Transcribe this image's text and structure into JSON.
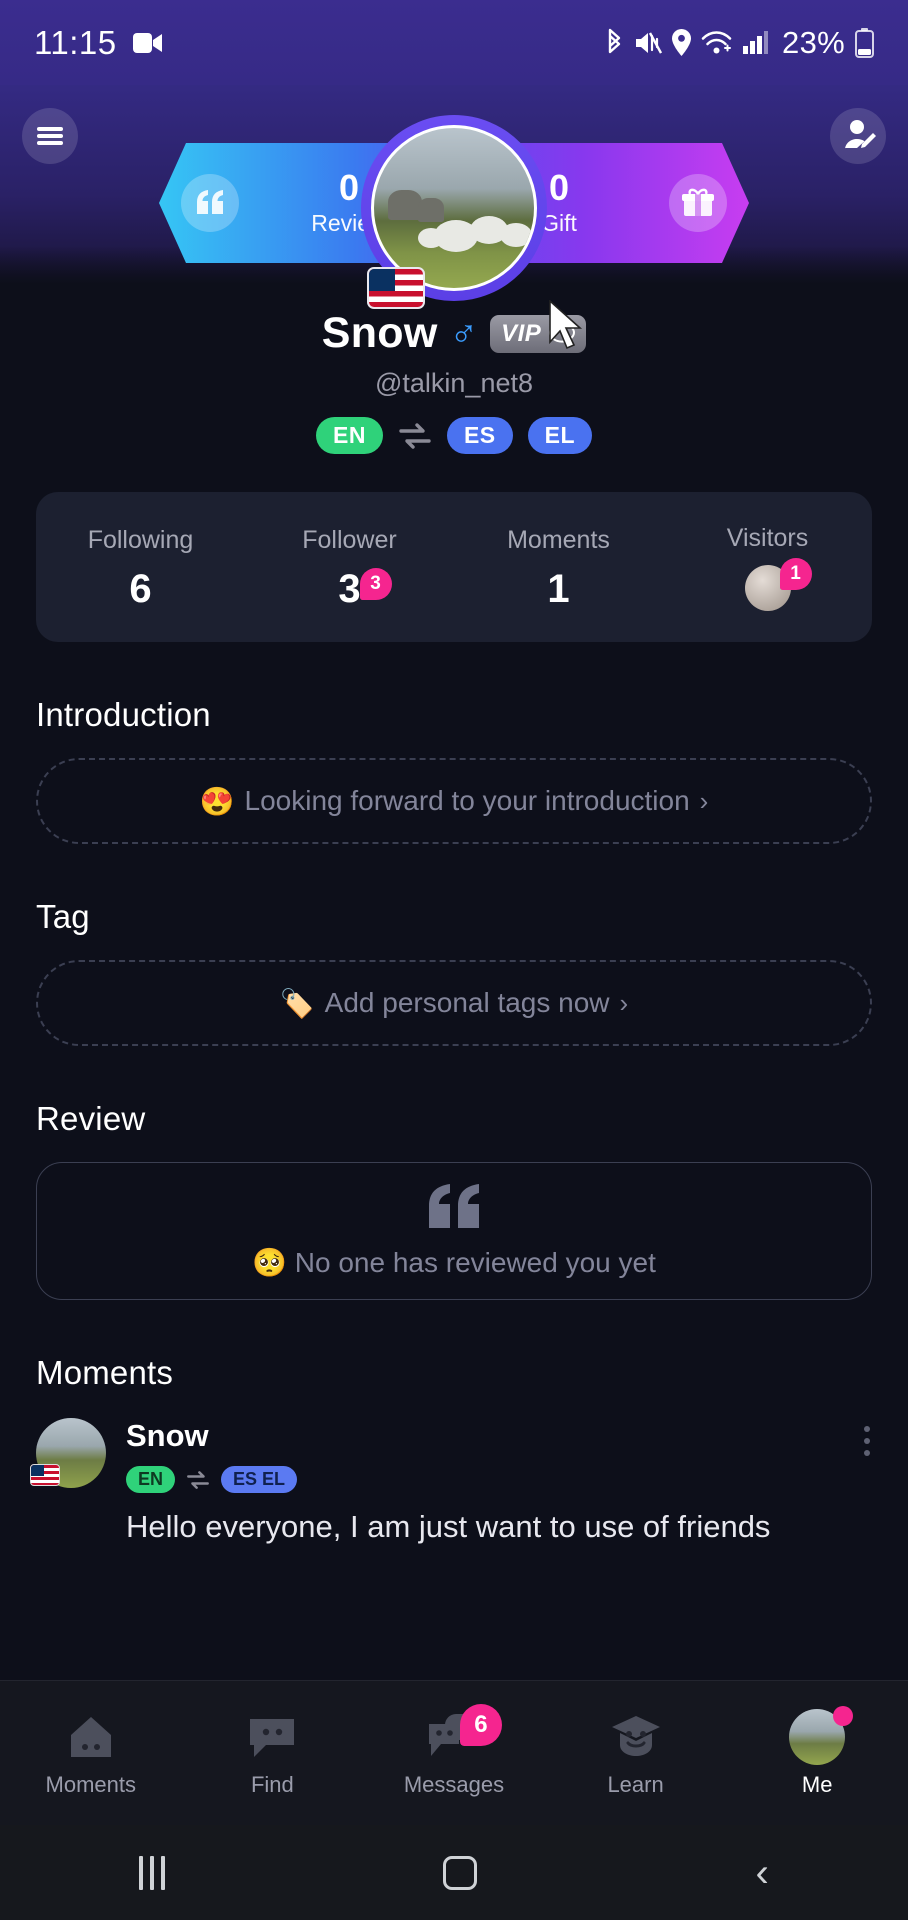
{
  "statusbar": {
    "time": "11:15",
    "battery_percent": "23%",
    "icons": [
      "video-camera-icon",
      "bluetooth-icon",
      "mute-icon",
      "location-icon",
      "wifi-icon",
      "cellular-signal-icon",
      "battery-icon"
    ]
  },
  "header": {
    "menu_icon": "hamburger-menu-icon",
    "edit_profile_icon": "edit-profile-icon",
    "review": {
      "count": "0",
      "label": "Review",
      "icon": "quote-icon"
    },
    "gift": {
      "count": "0",
      "label": "Gift",
      "icon": "gift-icon"
    },
    "avatar_flag": "us-flag-icon"
  },
  "identity": {
    "name": "Snow",
    "gender_icon": "male-gender-icon",
    "vip_label": "VIP",
    "vip_icon": "speech-bubble-icon",
    "handle": "@talkin_net8",
    "native_language": "EN",
    "swap_icon": "language-swap-icon",
    "learning_languages": [
      "ES",
      "EL"
    ]
  },
  "stats": [
    {
      "label": "Following",
      "value": "6",
      "badge": ""
    },
    {
      "label": "Follower",
      "value": "3",
      "badge": "3"
    },
    {
      "label": "Moments",
      "value": "1",
      "badge": ""
    },
    {
      "label": "Visitors",
      "value": "",
      "badge": "1"
    }
  ],
  "introduction": {
    "title": "Introduction",
    "placeholder": "Looking forward to your introduction",
    "emoji": "😍",
    "chevron": "›"
  },
  "tag": {
    "title": "Tag",
    "placeholder": "Add personal tags now",
    "emoji": "🏷️",
    "chevron": "›"
  },
  "review_section": {
    "title": "Review",
    "quote_icon": "quote-icon",
    "empty_text": "No one has reviewed you yet",
    "emoji": "🥺"
  },
  "moments_section": {
    "title": "Moments",
    "post": {
      "author": "Snow",
      "native_language": "EN",
      "swap_icon": "language-swap-icon",
      "learning_languages": "ES EL",
      "text": "Hello everyone, I am just want to use of friends",
      "more_icon": "more-vertical-icon"
    }
  },
  "tabbar": [
    {
      "label": "Moments",
      "icon": "home-icon",
      "badge": "",
      "active": false
    },
    {
      "label": "Find",
      "icon": "chat-bubble-icon",
      "badge": "",
      "active": false
    },
    {
      "label": "Messages",
      "icon": "messages-icon",
      "badge": "6",
      "active": false
    },
    {
      "label": "Learn",
      "icon": "graduation-cap-icon",
      "badge": "",
      "active": false
    },
    {
      "label": "Me",
      "icon": "profile-avatar-icon",
      "badge": "dot",
      "active": true
    }
  ],
  "navbar": {
    "recents": "recents-icon",
    "home": "home-button-icon",
    "back": "back-button-icon"
  },
  "colors": {
    "accent_pink": "#f5258f",
    "green": "#2fd27a",
    "blue": "#4a72f0",
    "purple": "#5b3fe6",
    "background": "#0d0f1a"
  }
}
